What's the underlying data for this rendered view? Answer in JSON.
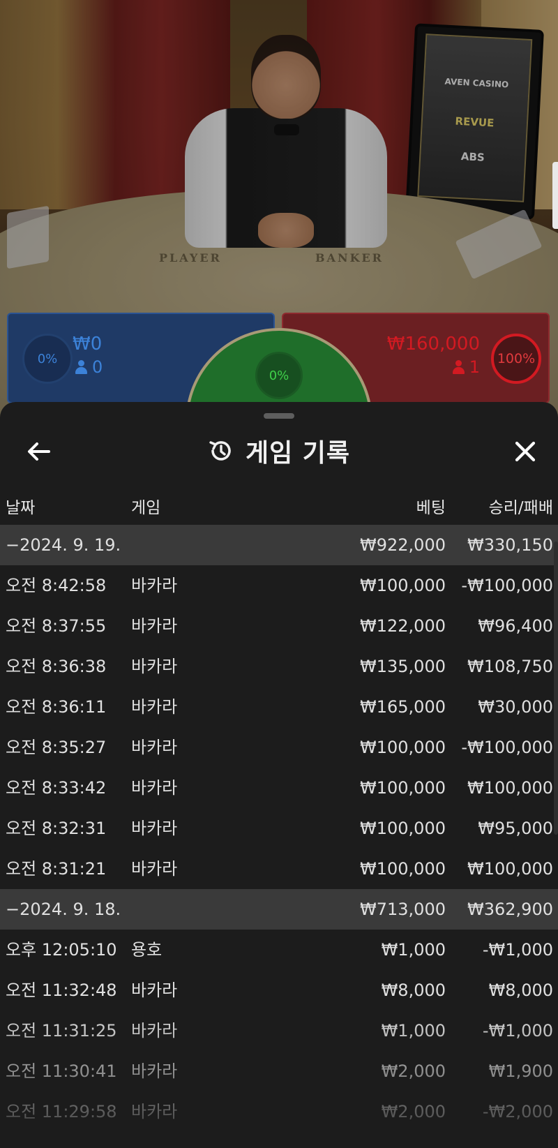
{
  "video": {
    "felt_player": "PLAYER",
    "felt_banker": "BANKER",
    "monitor_logos": [
      "AVEN CASINO",
      "REVUE",
      "ABS"
    ]
  },
  "bets": {
    "player": {
      "percent": "0%",
      "amount": "₩0",
      "count": "0",
      "color": "#3c82d8"
    },
    "tie": {
      "percent": "0%",
      "color": "#3fd04a"
    },
    "banker": {
      "percent": "100%",
      "amount": "₩160,000",
      "count": "1",
      "color": "#d21a22"
    }
  },
  "history": {
    "title": "게임 기록",
    "columns": {
      "date": "날짜",
      "game": "게임",
      "bet": "베팅",
      "result": "승리/패배"
    },
    "rows": [
      {
        "type": "group",
        "date": "−2024. 9. 19.",
        "game": "",
        "bet": "₩922,000",
        "result": "₩330,150"
      },
      {
        "type": "item",
        "date": "오전 8:42:58",
        "game": "바카라",
        "bet": "₩100,000",
        "result": "-₩100,000"
      },
      {
        "type": "item",
        "date": "오전 8:37:55",
        "game": "바카라",
        "bet": "₩122,000",
        "result": "₩96,400"
      },
      {
        "type": "item",
        "date": "오전 8:36:38",
        "game": "바카라",
        "bet": "₩135,000",
        "result": "₩108,750"
      },
      {
        "type": "item",
        "date": "오전 8:36:11",
        "game": "바카라",
        "bet": "₩165,000",
        "result": "₩30,000"
      },
      {
        "type": "item",
        "date": "오전 8:35:27",
        "game": "바카라",
        "bet": "₩100,000",
        "result": "-₩100,000"
      },
      {
        "type": "item",
        "date": "오전 8:33:42",
        "game": "바카라",
        "bet": "₩100,000",
        "result": "₩100,000"
      },
      {
        "type": "item",
        "date": "오전 8:32:31",
        "game": "바카라",
        "bet": "₩100,000",
        "result": "₩95,000"
      },
      {
        "type": "item",
        "date": "오전 8:31:21",
        "game": "바카라",
        "bet": "₩100,000",
        "result": "₩100,000"
      },
      {
        "type": "group",
        "date": "−2024. 9. 18.",
        "game": "",
        "bet": "₩713,000",
        "result": "₩362,900"
      },
      {
        "type": "item",
        "date": "오후 12:05:10",
        "game": "용호",
        "bet": "₩1,000",
        "result": "-₩1,000"
      },
      {
        "type": "item",
        "date": "오전 11:32:48",
        "game": "바카라",
        "bet": "₩8,000",
        "result": "₩8,000"
      },
      {
        "type": "item",
        "date": "오전 11:31:25",
        "game": "바카라",
        "bet": "₩1,000",
        "result": "-₩1,000"
      },
      {
        "type": "item",
        "date": "오전 11:30:41",
        "game": "바카라",
        "bet": "₩2,000",
        "result": "₩1,900"
      },
      {
        "type": "item",
        "date": "오전 11:29:58",
        "game": "바카라",
        "bet": "₩2,000",
        "result": "-₩2,000"
      }
    ]
  },
  "icons": {
    "back": "arrow-left-icon",
    "history": "history-icon",
    "close": "close-icon",
    "player_count": "person-icon"
  }
}
